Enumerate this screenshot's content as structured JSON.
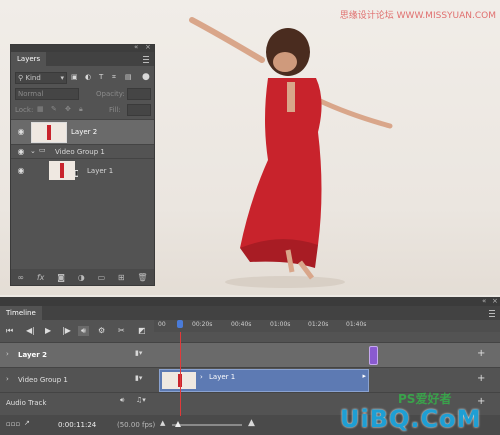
{
  "watermark": "思缘设计论坛 WWW.MISSYUAN.COM",
  "layers_panel": {
    "tab": "Layers",
    "filter_kind": "Kind",
    "blend_mode": "Normal",
    "opacity_label": "Opacity:",
    "lock_label": "Lock:",
    "fill_label": "Fill:",
    "layers": [
      {
        "name": "Layer 2"
      },
      {
        "name": "Video Group 1"
      },
      {
        "name": "Layer 1"
      }
    ],
    "bottom_icons": [
      "link-icon",
      "fx-icon",
      "mask-icon",
      "adjustment-icon",
      "folder-icon",
      "new-layer-icon",
      "trash-icon"
    ]
  },
  "timeline": {
    "tab": "Timeline",
    "ruler": [
      "00",
      "00:20s",
      "00:40s",
      "01:00s",
      "01:20s",
      "01:40s"
    ],
    "tracks": [
      {
        "name": "Layer 2"
      },
      {
        "name": "Video Group 1",
        "clip_label": "Layer 1"
      },
      {
        "name": "Audio Track"
      }
    ],
    "timecode": "0:00:11:24",
    "fps": "(50.00 fps)"
  },
  "footer_logo": "UiBQ.CoM",
  "footer_stamp": "PS爱好者"
}
